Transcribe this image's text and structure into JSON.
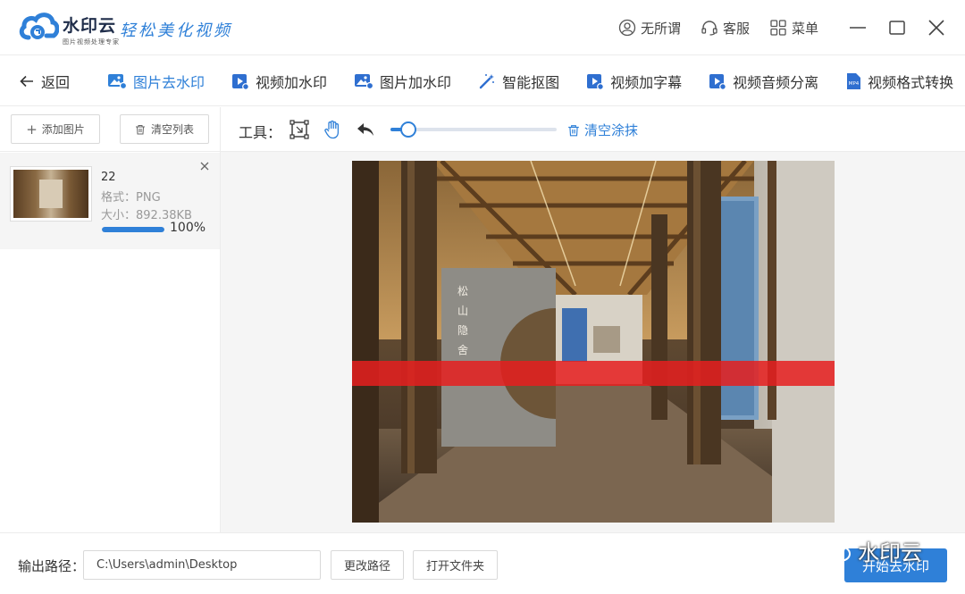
{
  "app": {
    "brand_name": "水印云",
    "brand_sub": "图片视频处理专家",
    "slogan": "轻松美化视频",
    "header_links": [
      {
        "label": "无所谓",
        "icon": "user-icon"
      },
      {
        "label": "客服",
        "icon": "headset-icon"
      },
      {
        "label": "菜单",
        "icon": "grid-menu-icon"
      }
    ]
  },
  "nav": {
    "back_label": "返回",
    "items": [
      {
        "label": "图片去水印",
        "active": true,
        "icon": "image-remove-icon"
      },
      {
        "label": "视频加水印",
        "active": false,
        "icon": "video-icon"
      },
      {
        "label": "图片加水印",
        "active": false,
        "icon": "image-icon"
      },
      {
        "label": "智能抠图",
        "active": false,
        "icon": "magic-wand-icon"
      },
      {
        "label": "视频加字幕",
        "active": false,
        "icon": "video-subtitle-icon"
      },
      {
        "label": "视频音频分离",
        "active": false,
        "icon": "video-audio-icon"
      },
      {
        "label": "视频格式转换",
        "active": false,
        "icon": "mp4-file-icon"
      }
    ]
  },
  "left": {
    "add_label": "添加图片",
    "clear_label": "清空列表",
    "files": [
      {
        "name": "22",
        "format": "格式：PNG",
        "size": "大小：892.38KB",
        "progress_text": "100%",
        "progress": 1.0
      }
    ]
  },
  "tools": {
    "label": "工具：",
    "brush_size": 0.11,
    "clear_label": "清空涂抹"
  },
  "preview": {
    "sign_text": "松山隐舍"
  },
  "bottom": {
    "output_label": "输出路径：",
    "output_path": "C:\\Users\\admin\\Desktop",
    "change_path_label": "更改路径",
    "open_folder_label": "打开文件夹",
    "start_label": "开始去水印",
    "watermark_text": "水印云"
  },
  "colors": {
    "accent": "#2f80d8",
    "watermark_red": "#e61e1e"
  }
}
